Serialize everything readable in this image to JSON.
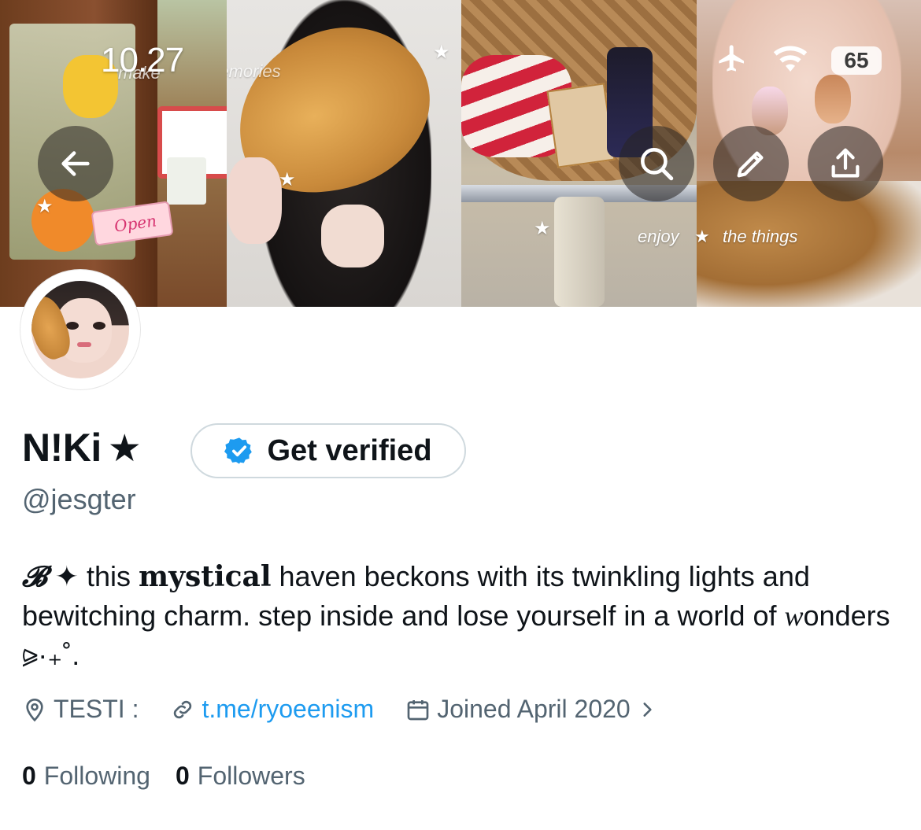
{
  "status_bar": {
    "time": "10.27",
    "battery": "65",
    "icons": [
      "airplane-icon",
      "wifi-icon",
      "battery-icon"
    ]
  },
  "banner": {
    "overlay_text_left": "make",
    "overlay_text_left2": "memories",
    "overlay_text_enjoy": "enjoy",
    "overlay_text_things": "the things",
    "sign_text": "Open"
  },
  "nav": {
    "back_icon": "arrow-left-icon",
    "search_icon": "search-icon",
    "edit_icon": "pencil-icon",
    "share_icon": "share-icon"
  },
  "profile": {
    "display_name": "N!Ki",
    "name_symbol": "★",
    "verify_label": "Get verified",
    "handle": "@jesgter",
    "bio": {
      "prefix_symbol": "𝓑",
      "sparkle": "✦",
      "word1": " this ",
      "mystical": "mystical",
      "rest1": " haven beckons with its twinkling lights and bewitching charm. step inside and lose yourself in a world of ",
      "w": "w",
      "onders": "onders",
      "tail": " ⪩·₊˚."
    },
    "location": "TESTI :",
    "link": "t.me/ryoeenism",
    "joined": "Joined April 2020",
    "following_count": "0",
    "following_label": "Following",
    "followers_count": "0",
    "followers_label": "Followers"
  },
  "colors": {
    "accent": "#1d9bf0",
    "text_primary": "#0f1419",
    "text_secondary": "#536471",
    "border": "#cfd9de"
  }
}
